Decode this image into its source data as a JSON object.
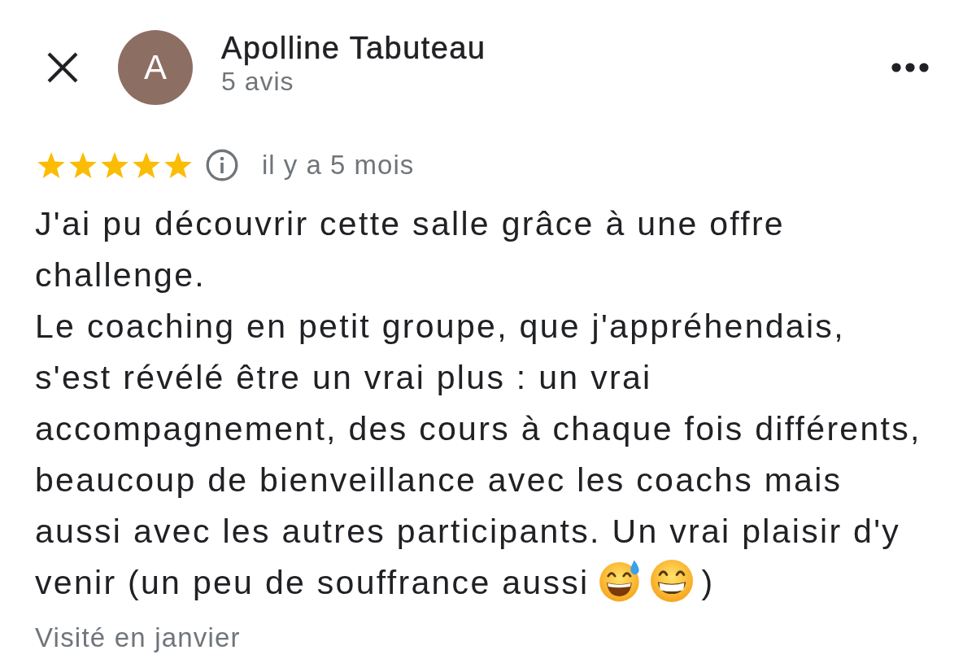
{
  "header": {
    "avatar": {
      "initial": "A"
    },
    "name": "Apolline Tabuteau",
    "review_count": "5 avis"
  },
  "review": {
    "stars": 5,
    "time": "il y a 5 mois",
    "text": "J'ai pu découvrir cette salle grâce à une offre\nchallenge.\nLe coaching en petit groupe, que j'appréhendais,\ns'est révélé être un vrai plus : un vrai\naccompagnement, des cours à chaque fois différents,\nbeaucoup de bienveillance avec les coachs mais\naussi avec les autres participants. Un vrai plaisir d'y\nvenir (un peu de souffrance aussi",
    "emojis": [
      {
        "kind": "sweat-smile"
      },
      {
        "kind": "grin"
      }
    ],
    "text_after": ")",
    "visited": "Visité en janvier"
  }
}
